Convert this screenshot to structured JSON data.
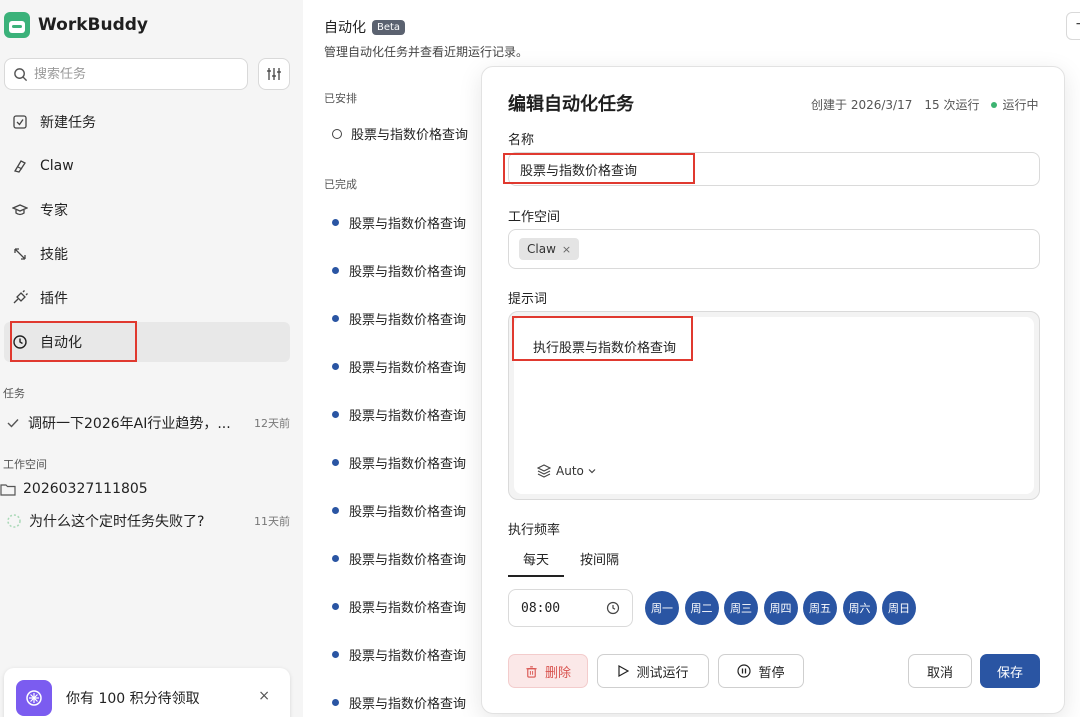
{
  "app": {
    "name": "WorkBuddy"
  },
  "sidebar": {
    "search_placeholder": "搜索任务",
    "nav": [
      {
        "label": "新建任务",
        "icon": "new-task-icon"
      },
      {
        "label": "Claw",
        "icon": "claw-icon"
      },
      {
        "label": "专家",
        "icon": "expert-icon"
      },
      {
        "label": "技能",
        "icon": "skill-icon"
      },
      {
        "label": "插件",
        "icon": "plugin-icon"
      },
      {
        "label": "自动化",
        "icon": "clock-icon",
        "active": true
      }
    ],
    "tasks_label": "任务",
    "tasks": [
      {
        "title": "调研一下2026年AI行业趋势，...",
        "time": "12天前"
      }
    ],
    "workspace_label": "工作空间",
    "workspace": {
      "folder": "20260327111805",
      "item": "为什么这个定时任务失败了?",
      "time": "11天前"
    },
    "promo": "你有 100 积分待领取",
    "promo_close": "×"
  },
  "main": {
    "title": "自动化",
    "badge": "Beta",
    "subtitle": "管理自动化任务并查看近期运行记录。",
    "scheduled_label": "已安排",
    "scheduled": [
      "股票与指数价格查询"
    ],
    "done_label": "已完成",
    "done": [
      "股票与指数价格查询",
      "股票与指数价格查询",
      "股票与指数价格查询",
      "股票与指数价格查询",
      "股票与指数价格查询",
      "股票与指数价格查询",
      "股票与指数价格查询",
      "股票与指数价格查询",
      "股票与指数价格查询",
      "股票与指数价格查询",
      "股票与指数价格查询"
    ],
    "corner_button": "+"
  },
  "modal": {
    "title": "编辑自动化任务",
    "created": "创建于 2026/3/17",
    "runs": "15 次运行",
    "status": "运行中",
    "name_label": "名称",
    "name_value": "股票与指数价格查询",
    "workspace_label": "工作空间",
    "workspace_chip": "Claw",
    "chip_remove": "×",
    "prompt_label": "提示词",
    "prompt_value": "执行股票与指数价格查询",
    "model_select": "Auto",
    "freq_label": "执行频率",
    "freq_tabs": [
      "每天",
      "按间隔"
    ],
    "time_value": "08:00",
    "days": [
      "周一",
      "周二",
      "周三",
      "周四",
      "周五",
      "周六",
      "周日"
    ],
    "buttons": {
      "delete": "删除",
      "test": "测试运行",
      "pause": "暂停",
      "cancel": "取消",
      "save": "保存"
    },
    "colors": {
      "primary": "#2a55a3",
      "danger": "#d9534f",
      "highlight": "#e0392f",
      "status": "#3cb371"
    }
  }
}
